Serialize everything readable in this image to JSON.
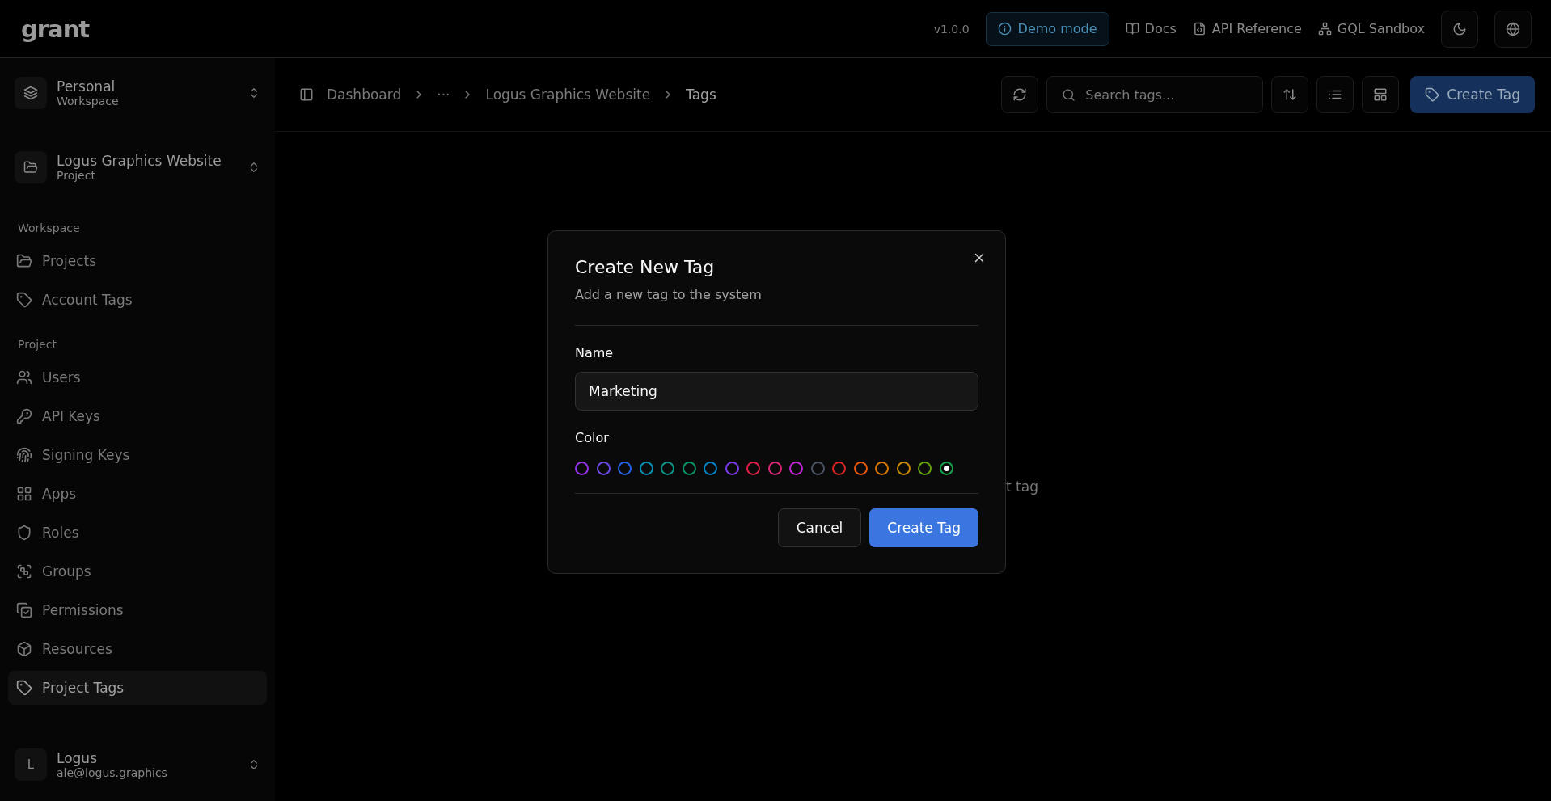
{
  "header": {
    "logo": "grant",
    "version": "v1.0.0",
    "demo_button": "Demo mode",
    "links": [
      "Docs",
      "API Reference",
      "GQL Sandbox"
    ]
  },
  "sidebar": {
    "switchers": [
      {
        "title": "Personal",
        "subtitle": "Workspace"
      },
      {
        "title": "Logus Graphics Website",
        "subtitle": "Project"
      }
    ],
    "sections": [
      {
        "title": "Workspace",
        "items": [
          {
            "label": "Projects",
            "selected": false
          },
          {
            "label": "Account Tags",
            "selected": false
          }
        ]
      },
      {
        "title": "Project",
        "items": [
          {
            "label": "Users",
            "selected": false
          },
          {
            "label": "API Keys",
            "selected": false
          },
          {
            "label": "Signing Keys",
            "selected": false
          },
          {
            "label": "Apps",
            "selected": false
          },
          {
            "label": "Roles",
            "selected": false
          },
          {
            "label": "Groups",
            "selected": false
          },
          {
            "label": "Permissions",
            "selected": false
          },
          {
            "label": "Resources",
            "selected": false
          },
          {
            "label": "Project Tags",
            "selected": true
          }
        ]
      }
    ],
    "user": {
      "avatar": "L",
      "name": "Logus",
      "email": "ale@logus.graphics"
    }
  },
  "toolbar": {
    "breadcrumbs": [
      "Dashboard",
      "···",
      "Logus Graphics Website",
      "Tags"
    ],
    "search": {
      "placeholder": "Search tags..."
    },
    "create_button": "Create Tag"
  },
  "empty_state": {
    "text": "t tag"
  },
  "dialog": {
    "title": "Create New Tag",
    "description": "Add a new tag to the system",
    "name_label": "Name",
    "name_value": "Marketing",
    "color_label": "Color",
    "colors": [
      {
        "color": "#9333ea",
        "selected": false
      },
      {
        "color": "#6d4ae8",
        "selected": false
      },
      {
        "color": "#2563eb",
        "selected": false
      },
      {
        "color": "#0891b2",
        "selected": false
      },
      {
        "color": "#0d9488",
        "selected": false
      },
      {
        "color": "#059669",
        "selected": false
      },
      {
        "color": "#0284c7",
        "selected": false
      },
      {
        "color": "#7c3aed",
        "selected": false
      },
      {
        "color": "#e11d48",
        "selected": false
      },
      {
        "color": "#db2777",
        "selected": false
      },
      {
        "color": "#c026d3",
        "selected": false
      },
      {
        "color": "#4b5563",
        "selected": false
      },
      {
        "color": "#dc2626",
        "selected": false
      },
      {
        "color": "#ea580c",
        "selected": false
      },
      {
        "color": "#d97706",
        "selected": false
      },
      {
        "color": "#ca8a04",
        "selected": false
      },
      {
        "color": "#65a30d",
        "selected": false
      },
      {
        "color": "#16a34a",
        "selected": true
      }
    ],
    "buttons": [
      {
        "label": "Cancel",
        "kind": "secondary"
      },
      {
        "label": "Create Tag",
        "kind": "primary"
      }
    ]
  }
}
